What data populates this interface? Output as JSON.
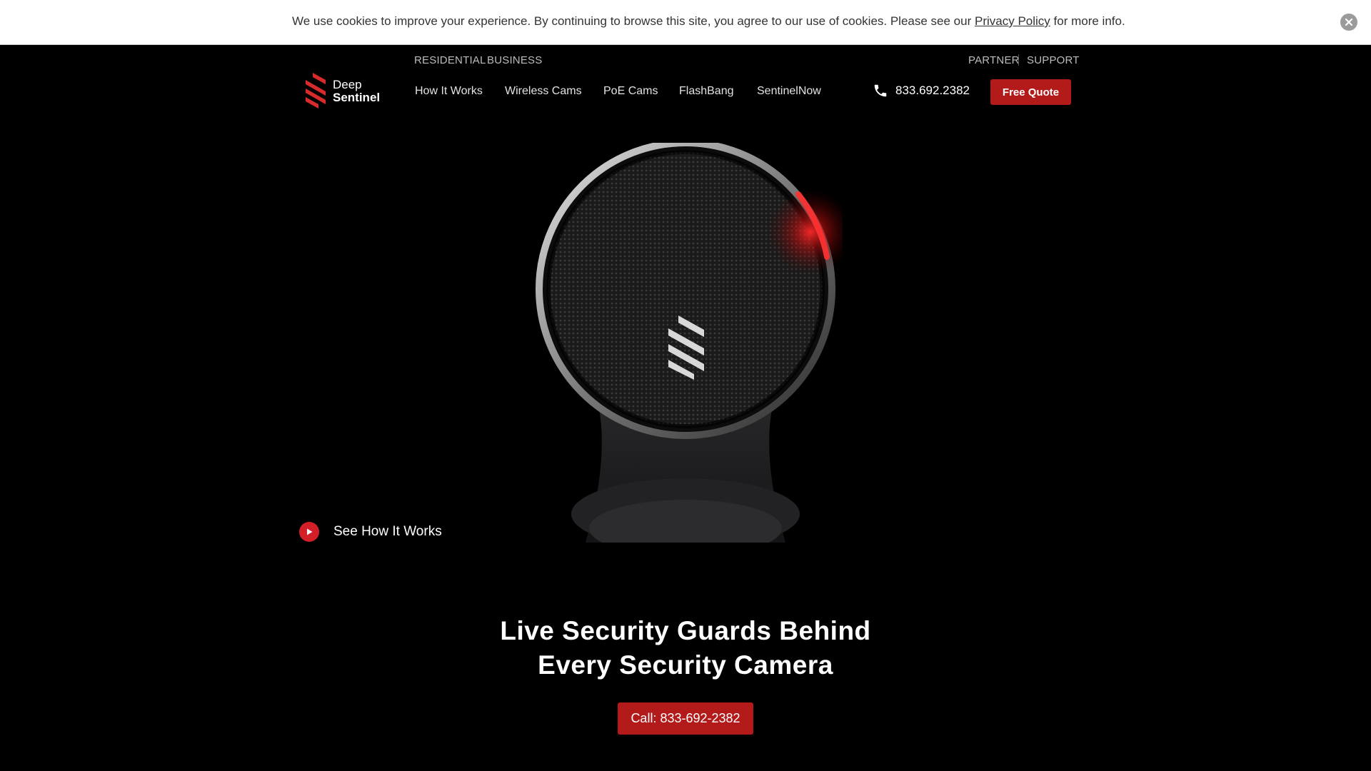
{
  "cookie": {
    "text_before": "We use cookies to improve your experience. By continuing to browse this site, you agree to our use of cookies. Please see our ",
    "link": "Privacy Policy",
    "text_after": " for more info."
  },
  "top_nav": {
    "left": [
      "RESIDENTIAL",
      "BUSINESS"
    ],
    "right": [
      "PARTNER",
      "SUPPORT"
    ]
  },
  "logo": {
    "line1": "Deep",
    "line2": "Sentinel"
  },
  "main_nav": [
    "How It Works",
    "Wireless Cams",
    "PoE Cams",
    "FlashBang",
    "SentinelNow"
  ],
  "phone": "833.692.2382",
  "quote_button": "Free Quote",
  "video_link": "See How It Works",
  "hero": {
    "headline_1": "Live Security Guards Behind",
    "headline_2": "Every Security Camera",
    "call_button": "Call: 833-692-2382"
  },
  "colors": {
    "accent": "#b31b1b",
    "play": "#d21f28",
    "background": "#000000"
  }
}
